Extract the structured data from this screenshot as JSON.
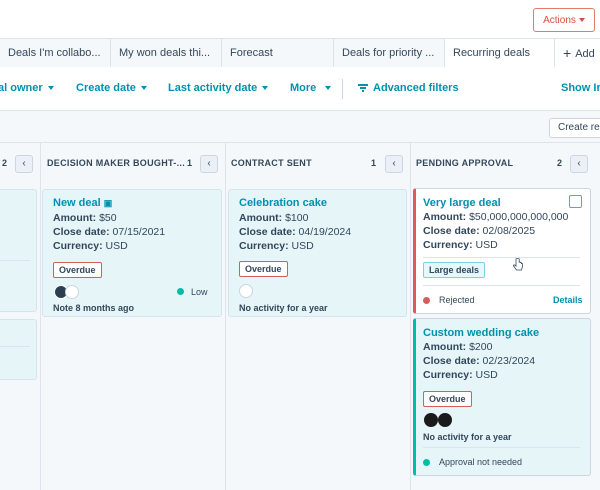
{
  "header": {
    "actions_label": "Actions"
  },
  "tabs": [
    {
      "label": "Deals I'm collabo..."
    },
    {
      "label": "My won deals thi..."
    },
    {
      "label": "Forecast"
    },
    {
      "label": "Deals for priority ..."
    },
    {
      "label": "Recurring deals"
    }
  ],
  "add_tab_label": "Add",
  "filters": {
    "owner": "al owner",
    "create_date": "Create date",
    "last_activity": "Last activity date",
    "more": "More",
    "advanced": "Advanced filters",
    "show": "Show Ir"
  },
  "toolbar": {
    "create_report": "Create rep"
  },
  "columns": [
    {
      "count": "2"
    },
    {
      "title": "DECISION MAKER BOUGHT-...",
      "count": "1",
      "card": {
        "name": "New deal",
        "amount_label": "Amount:",
        "amount": "$50",
        "close_label": "Close date:",
        "close": "07/15/2021",
        "currency_label": "Currency:",
        "currency": "USD",
        "overdue": "Overdue",
        "priority": "Low",
        "activity": "Note 8 months ago"
      }
    },
    {
      "title": "CONTRACT SENT",
      "count": "1",
      "card": {
        "name": "Celebration cake",
        "amount_label": "Amount:",
        "amount": "$100",
        "close_label": "Close date:",
        "close": "04/19/2024",
        "currency_label": "Currency:",
        "currency": "USD",
        "overdue": "Overdue",
        "activity": "No activity for a year"
      }
    },
    {
      "title": "PENDING APPROVAL",
      "count": "2",
      "cards": [
        {
          "name": "Very large deal",
          "amount_label": "Amount:",
          "amount": "$50,000,000,000,000",
          "close_label": "Close date:",
          "close": "02/08/2025",
          "currency_label": "Currency:",
          "currency": "USD",
          "tag": "Large deals",
          "status": "Rejected",
          "details": "Details"
        },
        {
          "name": "Custom wedding cake",
          "amount_label": "Amount:",
          "amount": "$200",
          "close_label": "Close date:",
          "close": "02/23/2024",
          "currency_label": "Currency:",
          "currency": "USD",
          "overdue": "Overdue",
          "activity": "No activity for a year",
          "status": "Approval not needed"
        }
      ]
    }
  ],
  "colors": {
    "accent": "#0091ae",
    "danger": "#d45d5d",
    "teal": "#00bda5",
    "actions": "#d3513f"
  }
}
